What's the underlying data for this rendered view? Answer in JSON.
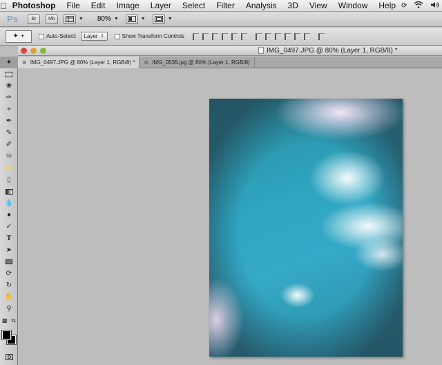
{
  "menubar": {
    "app_name": "Photoshop",
    "items": [
      "File",
      "Edit",
      "Image",
      "Layer",
      "Select",
      "Filter",
      "Analysis",
      "3D",
      "View",
      "Window",
      "Help"
    ]
  },
  "appbar": {
    "logo": "Ps",
    "br_label": "Br",
    "mb_label": "Mb",
    "zoom": "80%"
  },
  "options": {
    "auto_select_label": "Auto-Select:",
    "auto_select_value": "Layer",
    "show_transform_label": "Show Transform Controls"
  },
  "document": {
    "window_title": "IMG_0497.JPG @ 80% (Layer 1, RGB/8) *"
  },
  "tabs": [
    {
      "label": "IMG_0497.JPG @ 80% (Layer 1, RGB/8) *",
      "active": true
    },
    {
      "label": "IMG_0535.jpg @ 80% (Layer 1, RGB/8)",
      "active": false
    }
  ],
  "tools": [
    "move-tool",
    "marquee-tool",
    "lasso-tool",
    "quick-select-tool",
    "crop-tool",
    "eyedropper-tool",
    "healing-brush-tool",
    "brush-tool",
    "clone-stamp-tool",
    "history-brush-tool",
    "eraser-tool",
    "gradient-tool",
    "blur-tool",
    "dodge-tool",
    "pen-tool",
    "type-tool",
    "path-select-tool",
    "shape-tool",
    "3d-rotate-tool",
    "3d-orbit-tool",
    "hand-tool",
    "zoom-tool"
  ],
  "colors": {
    "foreground": "#000000",
    "background": "#000000"
  }
}
